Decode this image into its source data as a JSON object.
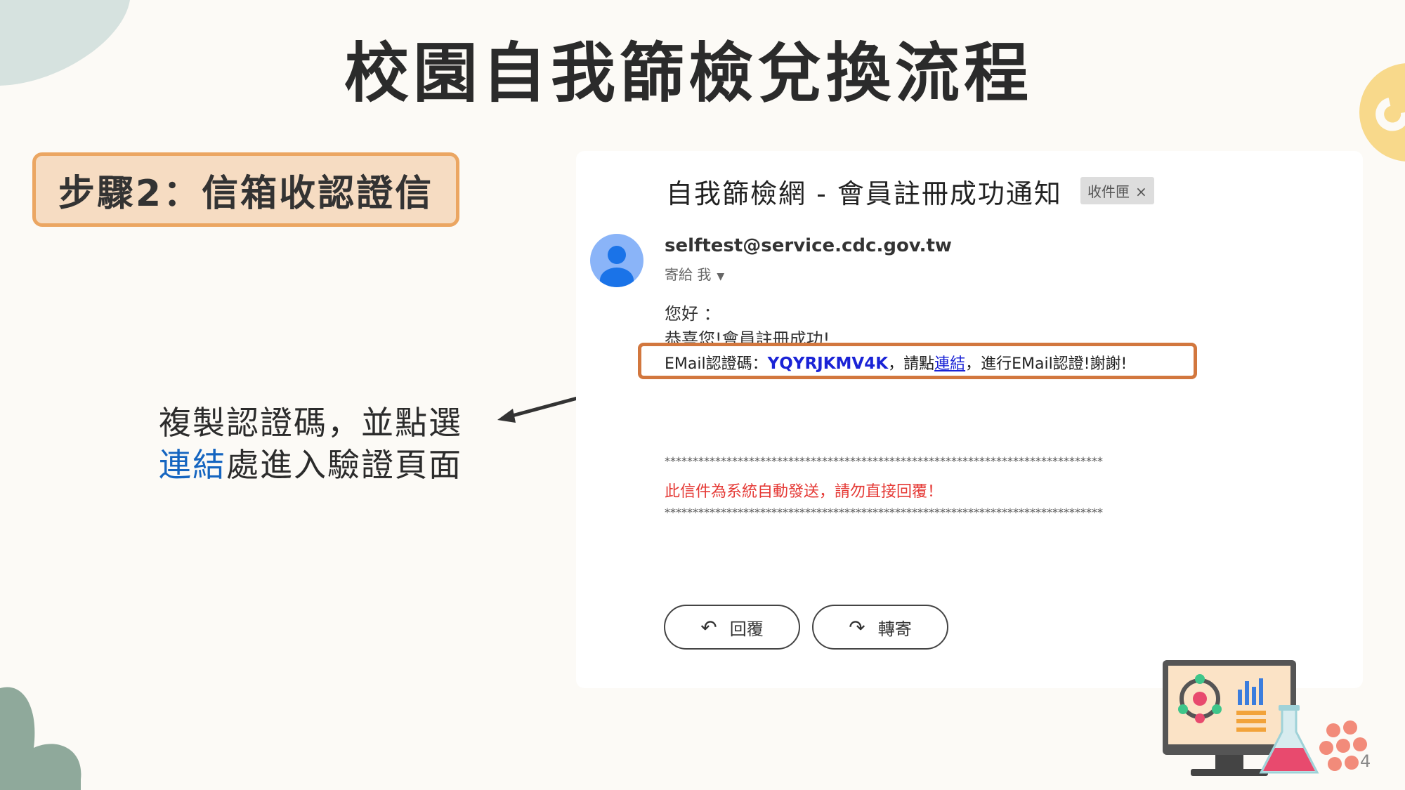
{
  "slide": {
    "title": "校園自我篩檢兌換流程",
    "step_label": "步驟2：信箱收認證信",
    "instruction_line1": "複製認證碼，並點選",
    "instruction_highlight": "連結",
    "instruction_line2_rest": "處進入驗證頁面",
    "page_number": "4"
  },
  "email": {
    "subject": "自我篩檢網 - 會員註冊成功通知",
    "label_chip": "收件匣",
    "label_chip_close": "×",
    "sender": "selftest@service.cdc.gov.tw",
    "to_line": "寄給 我",
    "greeting": "您好 ：",
    "congrats": "恭喜您!會員註冊成功!",
    "code_prefix": "EMail認證碼：",
    "code": "YQYRJKMV4K",
    "code_mid": "，請點",
    "link_text": "連結",
    "code_suffix": "，進行EMail認證!謝謝!",
    "stars": "******************************************************************************",
    "auto_note": "此信件為系統自動發送，請勿直接回覆！",
    "reply_label": "回覆",
    "forward_label": "轉寄"
  },
  "icons": {
    "avatar": "person-avatar-icon",
    "reply": "reply-arrow-icon",
    "forward": "forward-arrow-icon",
    "dropdown": "chevron-down-icon"
  },
  "colors": {
    "step_box_fill": "#f6dcc2",
    "step_box_border": "#eba662",
    "highlight_border": "#d2773e",
    "code_blue": "#1a23d6",
    "warning_red": "#e53935",
    "instruction_highlight": "#1565c0"
  }
}
